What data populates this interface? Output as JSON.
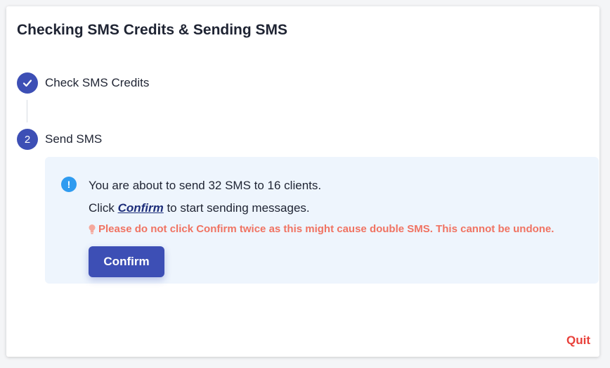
{
  "dialog": {
    "title": "Checking SMS Credits & Sending SMS"
  },
  "steps": [
    {
      "marker": "check",
      "label": "Check SMS Credits",
      "status": "completed"
    },
    {
      "marker": "2",
      "label": "Send SMS",
      "status": "active"
    }
  ],
  "message": {
    "icon": "info-icon",
    "summary": "You are about to send 32 SMS to 16 clients.",
    "instruction_prefix": "Click ",
    "instruction_link": "Confirm",
    "instruction_suffix": " to start sending messages.",
    "warning_icon": "lightbulb-icon",
    "warning": "Please do not click Confirm twice as this might cause double SMS. This cannot be undone."
  },
  "actions": {
    "confirm_label": "Confirm",
    "quit_label": "Quit"
  },
  "colors": {
    "primary": "#3d4fb5",
    "info": "#2f9bf0",
    "warning": "#f07362",
    "danger": "#e8403a",
    "panel_bg": "#eef5fd"
  }
}
